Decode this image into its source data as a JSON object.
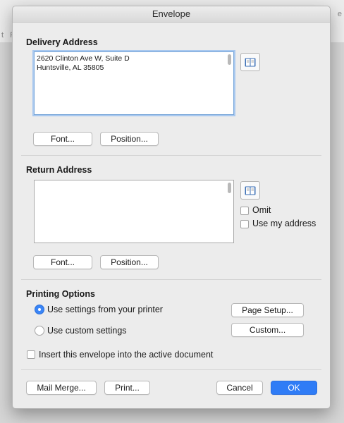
{
  "background": {
    "left_letters": "t  Re",
    "right_letter": "e"
  },
  "dialog": {
    "title": "Envelope",
    "delivery": {
      "heading": "Delivery Address",
      "lines": [
        "2620 Clinton Ave W, Suite D",
        "Huntsville, AL 35805"
      ],
      "font_button": "Font...",
      "position_button": "Position..."
    },
    "return": {
      "heading": "Return Address",
      "lines": [],
      "omit_label": "Omit",
      "use_my_address_label": "Use my address",
      "omit_checked": false,
      "use_my_address_checked": false,
      "font_button": "Font...",
      "position_button": "Position..."
    },
    "printing": {
      "heading": "Printing Options",
      "option_printer": "Use settings from your printer",
      "option_custom": "Use custom settings",
      "selected": "printer",
      "page_setup_button": "Page Setup...",
      "custom_button": "Custom..."
    },
    "insert_label": "Insert this envelope into the active document",
    "insert_checked": false,
    "footer": {
      "mail_merge_button": "Mail Merge...",
      "print_button": "Print...",
      "cancel_button": "Cancel",
      "ok_button": "OK"
    }
  },
  "colors": {
    "accent": "#2f7cf6",
    "dialog_bg": "#ececec"
  }
}
